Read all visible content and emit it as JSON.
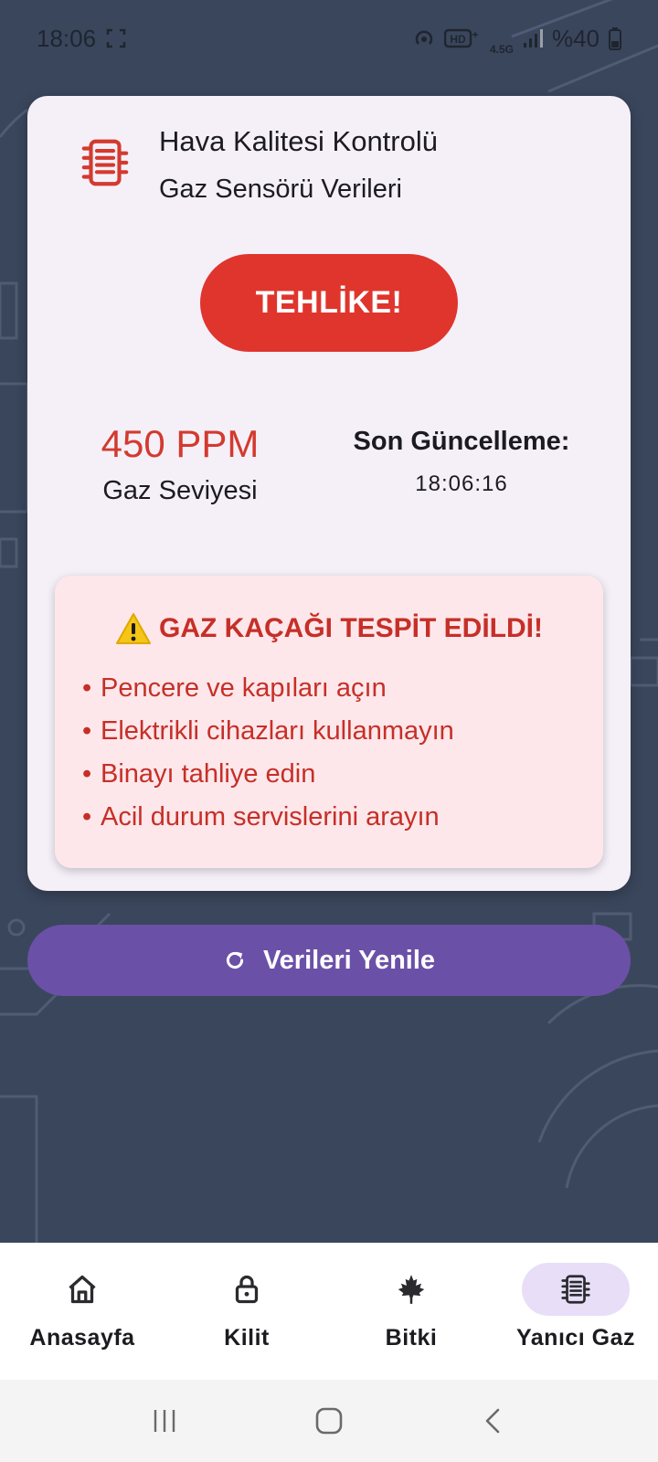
{
  "status_bar": {
    "time": "18:06",
    "network": "4.5G",
    "battery": "%40"
  },
  "card": {
    "title": "Hava Kalitesi Kontrolü",
    "subtitle": "Gaz Sensörü Verileri",
    "status_label": "TEHLİKE!",
    "gas_value": "450 PPM",
    "gas_label": "Gaz Seviyesi",
    "update_label": "Son Güncelleme:",
    "update_time": "18:06:16",
    "alert": {
      "title": "GAZ KAÇAĞI TESPİT EDİLDİ!",
      "items": [
        "Pencere ve kapıları açın",
        "Elektrikli cihazları kullanmayın",
        "Binayı tahliye edin",
        "Acil durum servislerini arayın"
      ]
    }
  },
  "refresh_button": {
    "label": "Verileri Yenile"
  },
  "bottom_nav": {
    "items": [
      {
        "label": "Anasayfa",
        "icon": "home-icon",
        "active": false
      },
      {
        "label": "Kilit",
        "icon": "lock-icon",
        "active": false
      },
      {
        "label": "Bitki",
        "icon": "leaf-icon",
        "active": false
      },
      {
        "label": "Yanıcı Gaz",
        "icon": "gas-sensor-icon",
        "active": true
      }
    ]
  },
  "colors": {
    "background": "#3a465c",
    "danger": "#df352d",
    "alert_bg": "#fde7ea",
    "primary": "#6b50a8",
    "nav_active": "#e8def8"
  }
}
